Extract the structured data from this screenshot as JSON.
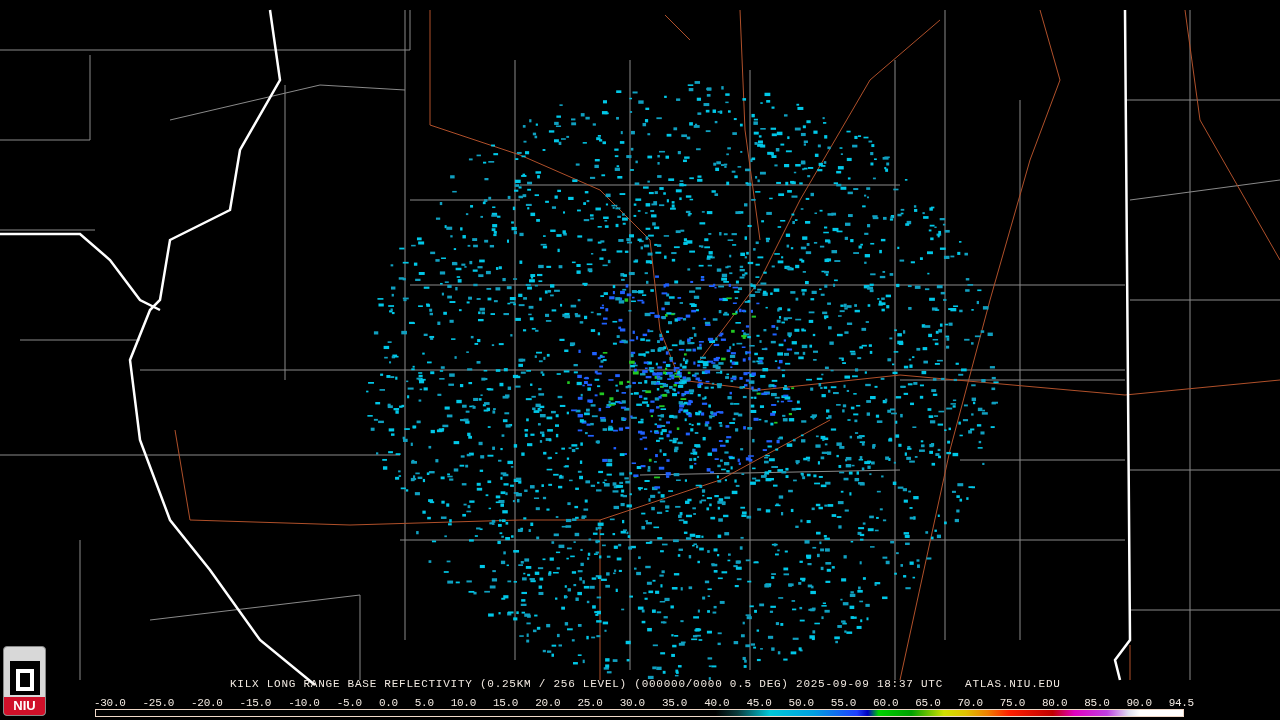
{
  "title": "KILX LONG RANGE BASE REFLECTIVITY (0.25KM / 256 LEVEL) (000000/0000 0.5 DEG) 2025-09-09 18:37 UTC",
  "site": "ATLAS.NIU.EDU",
  "logo": {
    "text": "NIU"
  },
  "legend": {
    "labels": [
      "-30.0",
      "-25.0",
      "-20.0",
      "-15.0",
      "-10.0",
      "-5.0",
      "0.0",
      "5.0",
      "10.0",
      "15.0",
      "20.0",
      "25.0",
      "30.0",
      "35.0",
      "40.0",
      "45.0",
      "50.0",
      "55.0",
      "60.0",
      "65.0",
      "70.0",
      "75.0",
      "80.0",
      "85.0",
      "90.0",
      "94.5"
    ]
  }
}
